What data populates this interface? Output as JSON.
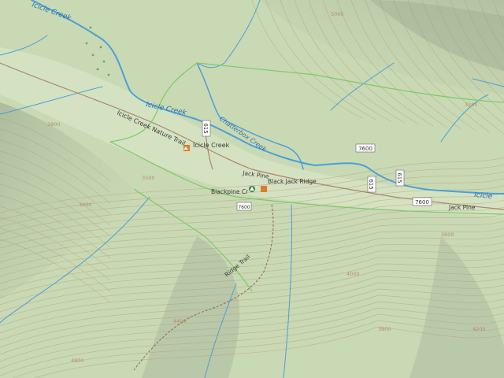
{
  "map": {
    "colors": {
      "terrain": "#c9d9b4",
      "terrain_light": "#d7e4c4",
      "shade": "#9fae93",
      "contour": "#b79a7c",
      "water": "#4a9fd8",
      "trail": "#7fc86a",
      "road": "#a9866c",
      "route_shield": "#ffffff",
      "poi": "#e07a2e",
      "campsite": "#3a8a4a"
    },
    "water_labels": {
      "icicle_creek_top": "Icicle Creek",
      "icicle_creek_mid": "Icicle Creek",
      "chatter_creek": "Chatterbox Creek",
      "icicle_right": "Icicle"
    },
    "place_labels": {
      "nature_trail": "Icicle Creek Nature Trail",
      "icicle_creek_poi": "Icicle Creek",
      "jack_pine_top": "Jack Pine",
      "black_jack_ridge": "Black Jack Ridge",
      "blackpine": "Blackpine Cr",
      "jack_pine_right": "Jack Pine",
      "ridge_trail": "Ridge Trail"
    },
    "route_shields": {
      "r1": "615",
      "r2": "7600",
      "r3": "7600",
      "r4": "615",
      "r5": "615",
      "r6": "7600"
    },
    "elevation_labels": [
      "3000",
      "3500",
      "4000",
      "3600",
      "4200",
      "3800",
      "4400",
      "4800",
      "5000",
      "2800",
      "3200"
    ]
  }
}
